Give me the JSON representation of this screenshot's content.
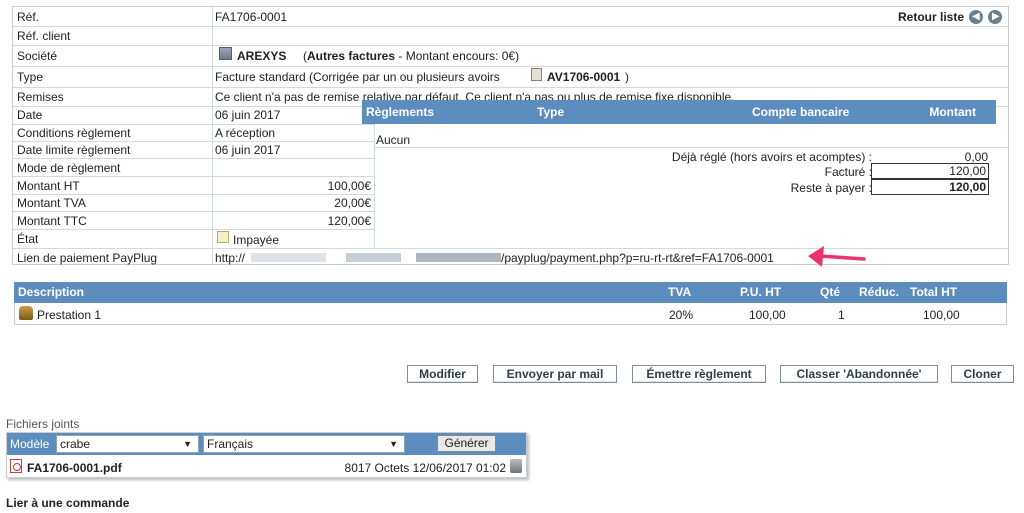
{
  "invoice": {
    "ref_label": "Réf.",
    "ref_value": "FA1706-0001",
    "back_link": "Retour liste",
    "ref_client_label": "Réf. client",
    "company_label": "Société",
    "company_name": "AREXYS",
    "company_extra_bold": "Autres factures",
    "company_extra_open": "(",
    "company_extra_rest": "- Montant encours: 0€)",
    "type_label": "Type",
    "type_value": "Facture standard (Corrigée par un ou plusieurs avoirs",
    "type_credit_ref": "AV1706-0001",
    "type_close": ")",
    "discount_label": "Remises",
    "discount_value": "Ce client n'a pas de remise relative par défaut. Ce client n'a pas ou plus de remise fixe disponible.",
    "date_label": "Date",
    "date_value": "06 juin 2017",
    "conditions_label": "Conditions règlement",
    "conditions_value": "A réception",
    "due_label": "Date limite règlement",
    "due_value": "06 juin 2017",
    "mode_label": "Mode de règlement",
    "mode_value": "",
    "ht_label": "Montant HT",
    "ht_value": "100,00€",
    "tva_label": "Montant TVA",
    "tva_value": "20,00€",
    "ttc_label": "Montant TTC",
    "ttc_value": "120,00€",
    "state_label": "État",
    "state_value": "Impayée",
    "paypal_label": "Lien de paiement PayPlug",
    "paypal_prefix": "http://",
    "paypal_suffix": "/payplug/payment.php?p=ru-rt-rt&ref=FA1706-0001"
  },
  "payments": {
    "col_payments": "Règlements",
    "col_type": "Type",
    "col_bank": "Compte bancaire",
    "col_amount": "Montant",
    "none": "Aucun",
    "paid_label": "Déjà réglé (hors avoirs et acomptes) :",
    "paid_value": "0,00",
    "billed_label": "Facturé :",
    "billed_value": "120,00",
    "remain_label": "Reste à payer :",
    "remain_value": "120,00"
  },
  "lines": {
    "headers": [
      "Description",
      "TVA",
      "P.U. HT",
      "Qté",
      "Réduc.",
      "Total HT"
    ],
    "rows": [
      {
        "description": "Prestation 1",
        "tva": "20%",
        "pu": "100,00",
        "qty": "1",
        "discount": "",
        "total": "100,00"
      }
    ]
  },
  "actions": {
    "edit": "Modifier",
    "send_mail": "Envoyer par mail",
    "payment": "Émettre règlement",
    "abandon": "Classer 'Abandonnée'",
    "clone": "Cloner"
  },
  "files": {
    "title": "Fichiers joints",
    "model_label": "Modèle",
    "model_value": "crabe",
    "lang_value": "Français",
    "generate": "Générer",
    "file_name": "FA1706-0001.pdf",
    "file_meta": "8017 Octets 12/06/2017 01:02"
  },
  "link_order": "Lier à une commande",
  "colors": {
    "header_blue": "#5d8dbf",
    "arrow_pink": "#e8336e"
  }
}
